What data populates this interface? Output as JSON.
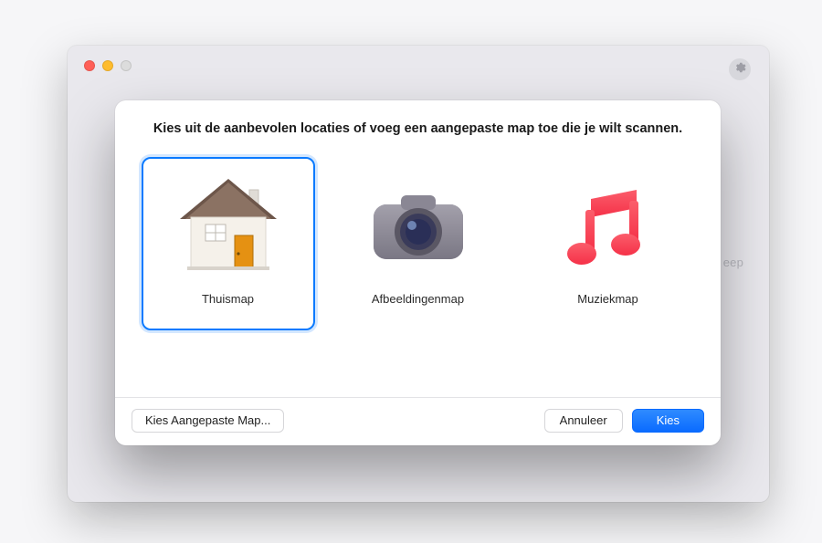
{
  "window": {
    "traffic_lights": {
      "close": "close",
      "minimize": "minimize",
      "maximize": "maximize"
    },
    "settings_icon": "gear-icon",
    "background_text": "eep"
  },
  "dialog": {
    "title": "Kies uit de aanbevolen locaties of voeg een aangepaste map toe die je wilt scannen.",
    "options": [
      {
        "id": "home",
        "label": "Thuismap",
        "icon": "house-icon",
        "selected": true
      },
      {
        "id": "images",
        "label": "Afbeeldingenmap",
        "icon": "camera-icon",
        "selected": false
      },
      {
        "id": "music",
        "label": "Muziekmap",
        "icon": "music-icon",
        "selected": false
      }
    ],
    "buttons": {
      "choose_custom": "Kies Aangepaste Map...",
      "cancel": "Annuleer",
      "choose": "Kies"
    },
    "colors": {
      "accent": "#0a7aff",
      "primary_button": "#0a6bff"
    }
  }
}
